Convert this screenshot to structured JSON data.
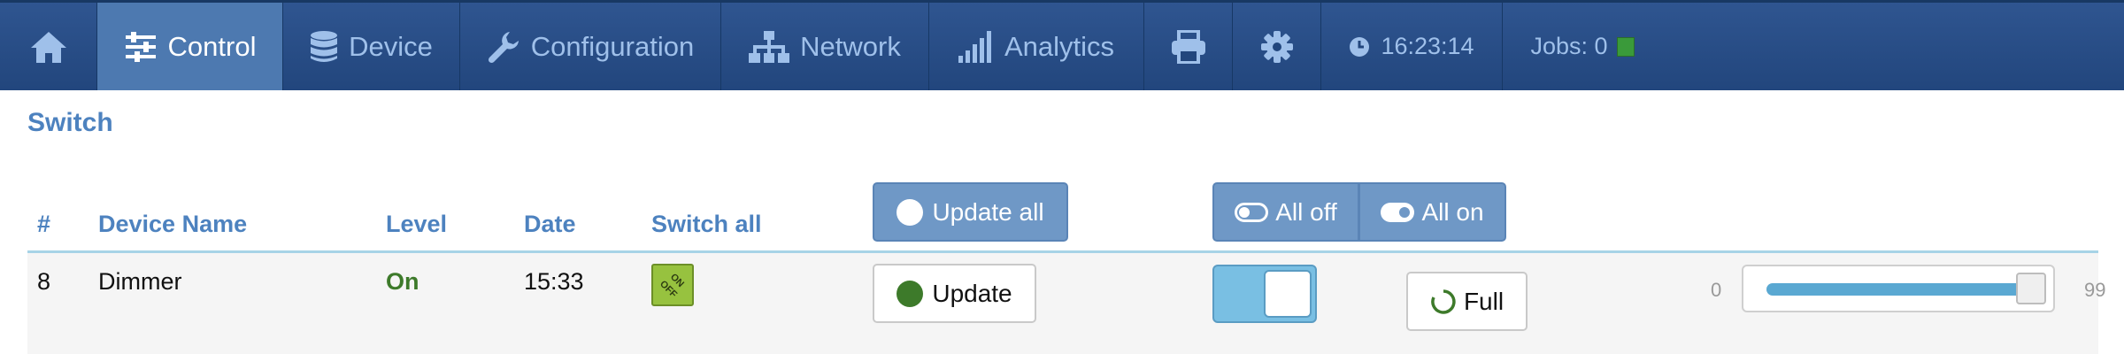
{
  "nav": {
    "items": [
      {
        "icon": "home-icon",
        "label": ""
      },
      {
        "icon": "sliders-icon",
        "label": "Control"
      },
      {
        "icon": "database-icon",
        "label": "Device"
      },
      {
        "icon": "wrench-icon",
        "label": "Configuration"
      },
      {
        "icon": "network-icon",
        "label": "Network"
      },
      {
        "icon": "signal-bars-icon",
        "label": "Analytics"
      },
      {
        "icon": "printer-icon",
        "label": ""
      },
      {
        "icon": "gear-icon",
        "label": ""
      },
      {
        "icon": "clock-icon",
        "label": "16:23:14"
      },
      {
        "icon": "",
        "label": "Jobs: 0"
      }
    ],
    "active_index": 1,
    "jobs_status_color": "#3a9a3a"
  },
  "section": {
    "title": "Switch"
  },
  "table": {
    "headers": {
      "num": "#",
      "device_name": "Device Name",
      "level": "Level",
      "date": "Date",
      "switch_all": "Switch all"
    },
    "toolbar": {
      "update_all": "Update all",
      "all_off": "All off",
      "all_on": "All on"
    },
    "rows": [
      {
        "num": "8",
        "device_name": "Dimmer",
        "level": "On",
        "date": "15:33",
        "switch_all_icon": "on-off-icon",
        "update_label": "Update",
        "toggle_state": "on",
        "full_label": "Full",
        "slider": {
          "min": "0",
          "max": "99",
          "value": 99
        }
      }
    ]
  },
  "colors": {
    "nav_bg": "#22467d",
    "nav_active": "#4d79b0",
    "accent": "#4d82bf",
    "level_on": "#3d7a2a",
    "toggle_on": "#79bfe3",
    "slider_fill": "#5aa8d2"
  }
}
